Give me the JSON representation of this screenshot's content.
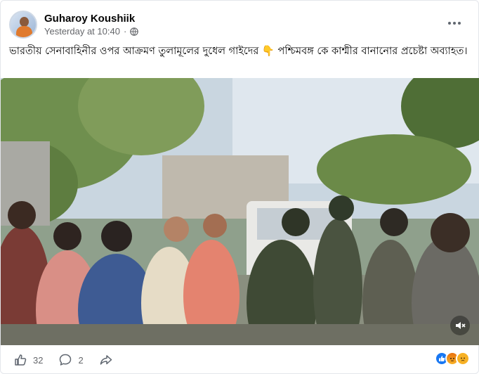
{
  "post": {
    "author": "Guharoy Koushiik",
    "timestamp": "Yesterday at 10:40",
    "separator": "·",
    "privacy_icon": "globe-icon",
    "more_icon": "more-options-icon",
    "caption": "ভারতীয় সেনাবাহিনীর ওপর আক্রমণ তুলামূলের দুধেল গাইদের 👇 পশ্চিমবঙ্গ কে কাশ্মীর বানানোর প্রচেষ্টা অব্যাহত।"
  },
  "video": {
    "mute_icon": "speaker-muted-icon"
  },
  "footer": {
    "like_count": "32",
    "comment_count": "2",
    "like_icon": "thumbs-up-icon",
    "comment_icon": "comment-bubble-icon",
    "share_icon": "share-arrow-icon",
    "reactions": [
      "like",
      "angry",
      "sad"
    ],
    "colors": {
      "like": "#1877f2",
      "angry": "#e9710f",
      "sad": "#f7b125"
    }
  }
}
